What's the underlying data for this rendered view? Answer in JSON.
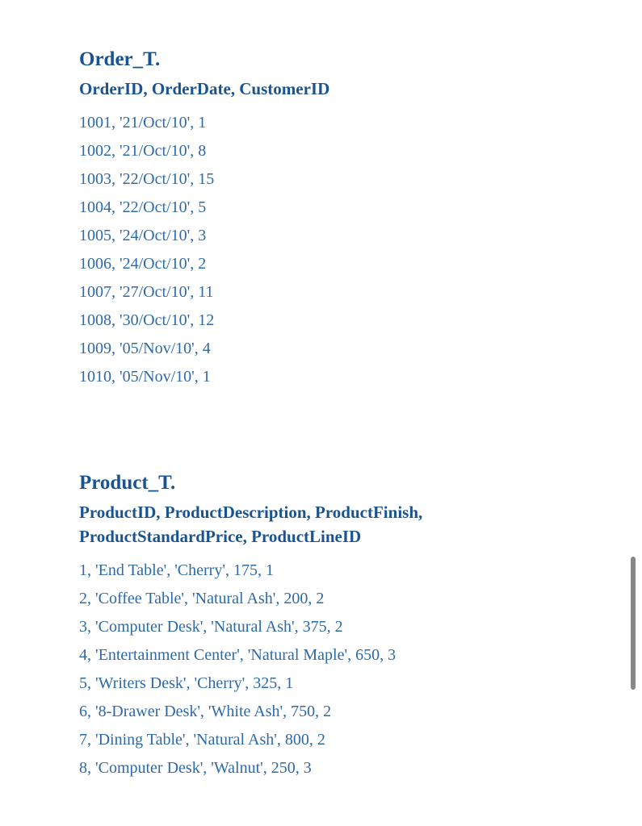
{
  "tables": [
    {
      "title": "Order_T.",
      "columns": "OrderID, OrderDate, CustomerID",
      "rows": [
        "1001, '21/Oct/10', 1",
        "1002, '21/Oct/10', 8",
        "1003, '22/Oct/10', 15",
        "1004, '22/Oct/10', 5",
        "1005, '24/Oct/10', 3",
        "1006, '24/Oct/10', 2",
        "1007, '27/Oct/10', 11",
        "1008, '30/Oct/10', 12",
        "1009, '05/Nov/10', 4",
        "1010, '05/Nov/10', 1"
      ]
    },
    {
      "title": "Product_T.",
      "columns": "ProductID, ProductDescription, ProductFinish, ProductStandardPrice, ProductLineID",
      "rows": [
        "1, 'End Table', 'Cherry', 175, 1",
        "2, 'Coffee Table', 'Natural Ash', 200, 2",
        "3, 'Computer Desk', 'Natural Ash', 375, 2",
        "4, 'Entertainment Center', 'Natural Maple', 650, 3",
        "5, 'Writers Desk', 'Cherry', 325, 1",
        "6, '8-Drawer Desk', 'White Ash', 750, 2",
        "7, 'Dining Table', 'Natural Ash', 800, 2",
        "8, 'Computer Desk', 'Walnut', 250, 3"
      ]
    }
  ]
}
